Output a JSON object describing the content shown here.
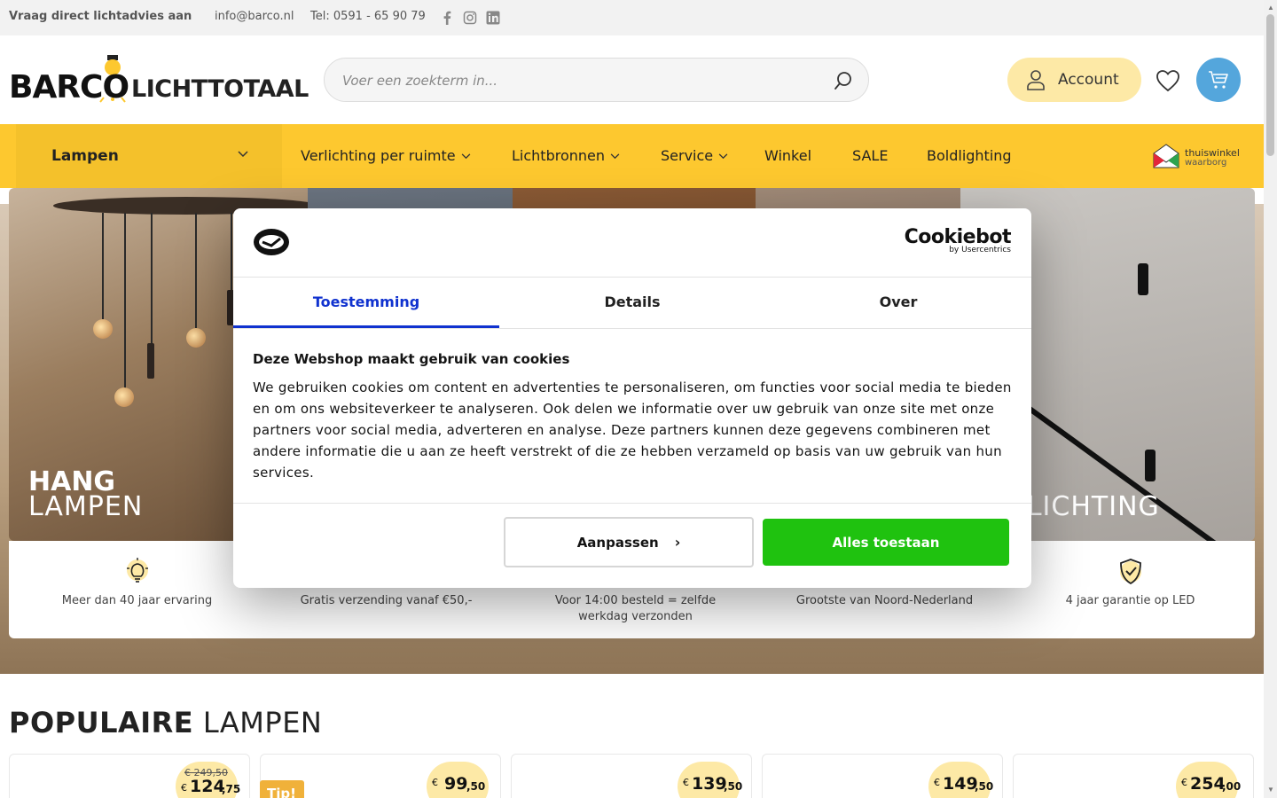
{
  "topbar": {
    "advice": "Vraag direct lichtadvies aan",
    "email": "info@barco.nl",
    "phone": "Tel: 0591 - 65 90 79",
    "social": [
      "facebook-icon",
      "instagram-icon",
      "linkedin-icon"
    ]
  },
  "header": {
    "logo_brand": "BARCO",
    "logo_sub": "LICHTTOTAAL",
    "search_placeholder": "Voer een zoekterm in...",
    "account_label": "Account"
  },
  "nav": {
    "category": "Lampen",
    "items": [
      {
        "label": "Verlichting per ruimte",
        "has_menu": true
      },
      {
        "label": "Lichtbronnen",
        "has_menu": true
      },
      {
        "label": "Service",
        "has_menu": true
      },
      {
        "label": "Winkel",
        "has_menu": false
      },
      {
        "label": "SALE",
        "has_menu": false
      },
      {
        "label": "Boldlighting",
        "has_menu": false
      }
    ],
    "trust_badge": {
      "line1": "thuiswinkel",
      "line2": "waarborg"
    }
  },
  "hero": {
    "tile1": {
      "bold": "HANG",
      "light": "LAMPEN"
    },
    "tile5": {
      "bold": "L",
      "light": "RLICHTING"
    }
  },
  "usps": [
    {
      "icon": "lightbulb-icon",
      "text": "Meer dan 40 jaar ervaring"
    },
    {
      "icon": "truck-icon",
      "text": "Gratis verzending vanaf €50,-"
    },
    {
      "icon": "clock-icon",
      "text": "Voor 14:00 besteld = zelfde werkdag verzonden"
    },
    {
      "icon": "store-icon",
      "text": "Grootste van Noord-Nederland"
    },
    {
      "icon": "shield-check-icon",
      "text": "4 jaar garantie op LED"
    }
  ],
  "popular": {
    "title_bold": "POPULAIRE",
    "title_light": "LAMPEN",
    "tip_label": "Tip!",
    "products": [
      {
        "old_price": "€ 249,50",
        "currency": "€",
        "price_main": "124",
        "price_cents": ",75"
      },
      {
        "old_price": "",
        "currency": "€",
        "price_main": "99",
        "price_cents": ",50"
      },
      {
        "old_price": "",
        "currency": "€",
        "price_main": "139",
        "price_cents": ",50"
      },
      {
        "old_price": "",
        "currency": "€",
        "price_main": "149",
        "price_cents": ",50"
      },
      {
        "old_price": "",
        "currency": "€",
        "price_main": "254",
        "price_cents": ",00"
      }
    ]
  },
  "cookie": {
    "brand": "Cookiebot",
    "brand_sub": "by Usercentrics",
    "tabs": [
      {
        "label": "Toestemming",
        "active": true
      },
      {
        "label": "Details",
        "active": false
      },
      {
        "label": "Over",
        "active": false
      }
    ],
    "heading": "Deze Webshop maakt gebruik van cookies",
    "body": "We gebruiken cookies om content en advertenties te personaliseren, om functies voor social media te bieden en om ons websiteverkeer te analyseren. Ook delen we informatie over uw gebruik van onze site met onze partners voor social media, adverteren en analyse. Deze partners kunnen deze gegevens combineren met andere informatie die u aan ze heeft verstrekt of die ze hebben verzameld op basis van uw gebruik van hun services.",
    "btn_customize": "Aanpassen",
    "btn_allow": "Alles toestaan",
    "accent_color": "#1032cf",
    "allow_color": "#1fc20f"
  },
  "colors": {
    "nav_yellow": "#fdc82f",
    "account_bg": "#fde9a6",
    "cart_blue": "#54a6dc"
  }
}
